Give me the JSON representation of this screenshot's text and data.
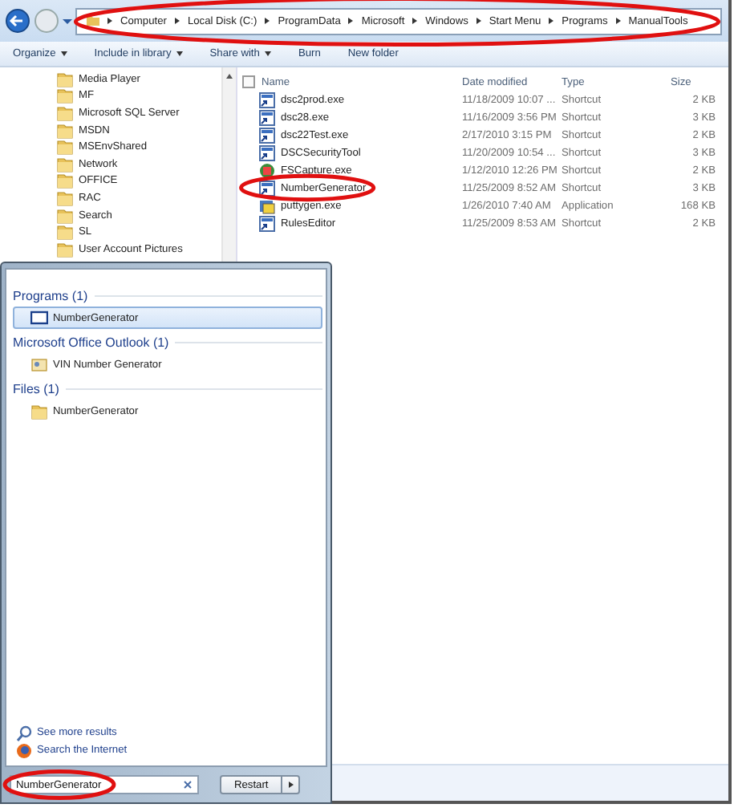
{
  "address_bar": {
    "circled": true,
    "crumbs": [
      "Computer",
      "Local Disk (C:)",
      "ProgramData",
      "Microsoft",
      "Windows",
      "Start Menu",
      "Programs",
      "ManualTools"
    ]
  },
  "toolbar": [
    {
      "label": "Organize",
      "dropdown": true
    },
    {
      "label": "Include in library",
      "dropdown": true
    },
    {
      "label": "Share with",
      "dropdown": true
    },
    {
      "label": "Burn",
      "dropdown": false
    },
    {
      "label": "New folder",
      "dropdown": false
    }
  ],
  "nav_tree": [
    "Media Player",
    "MF",
    "Microsoft SQL Server",
    "MSDN",
    "MSEnvShared",
    "Network",
    "OFFICE",
    "RAC",
    "Search",
    "SL",
    "User Account Pictures"
  ],
  "file_list": {
    "columns": [
      "Name",
      "Date modified",
      "Type",
      "Size"
    ],
    "select_all": {
      "checked": false
    },
    "rows": [
      {
        "name": "dsc2prod.exe",
        "date": "11/18/2009 10:07 ...",
        "type": "Shortcut",
        "size": "2 KB",
        "kind": "shortcut",
        "circled": false
      },
      {
        "name": "dsc28.exe",
        "date": "11/16/2009 3:56 PM",
        "type": "Shortcut",
        "size": "3 KB",
        "kind": "shortcut",
        "circled": false
      },
      {
        "name": "dsc22Test.exe",
        "date": "2/17/2010 3:15 PM",
        "type": "Shortcut",
        "size": "2 KB",
        "kind": "shortcut",
        "circled": false
      },
      {
        "name": "DSCSecurityTool",
        "date": "11/20/2009 10:54 ...",
        "type": "Shortcut",
        "size": "3 KB",
        "kind": "shortcut",
        "circled": false
      },
      {
        "name": "FSCapture.exe",
        "date": "1/12/2010 12:26 PM",
        "type": "Shortcut",
        "size": "2 KB",
        "kind": "capture",
        "circled": false
      },
      {
        "name": "NumberGenerator",
        "date": "11/25/2009 8:52 AM",
        "type": "Shortcut",
        "size": "3 KB",
        "kind": "shortcut",
        "circled": true
      },
      {
        "name": "puttygen.exe",
        "date": "1/26/2010 7:40 AM",
        "type": "Application",
        "size": "168 KB",
        "kind": "app",
        "circled": false
      },
      {
        "name": "RulesEditor",
        "date": "11/25/2009 8:53 AM",
        "type": "Shortcut",
        "size": "2 KB",
        "kind": "shortcut",
        "circled": false
      }
    ]
  },
  "start_menu": {
    "groups": [
      {
        "title": "Programs (1)",
        "items": [
          {
            "label": "NumberGenerator",
            "kind": "program",
            "selected": true
          }
        ]
      },
      {
        "title": "Microsoft Office Outlook (1)",
        "items": [
          {
            "label": "VIN Number Generator",
            "kind": "contact",
            "selected": false
          }
        ]
      },
      {
        "title": "Files (1)",
        "items": [
          {
            "label": "NumberGenerator",
            "kind": "folder",
            "selected": false
          }
        ]
      }
    ],
    "links": [
      {
        "label": "See more results",
        "kind": "search"
      },
      {
        "label": "Search the Internet",
        "kind": "browser"
      }
    ],
    "search": {
      "value": "NumberGenerator",
      "circled": true
    },
    "power_button": "Restart"
  }
}
